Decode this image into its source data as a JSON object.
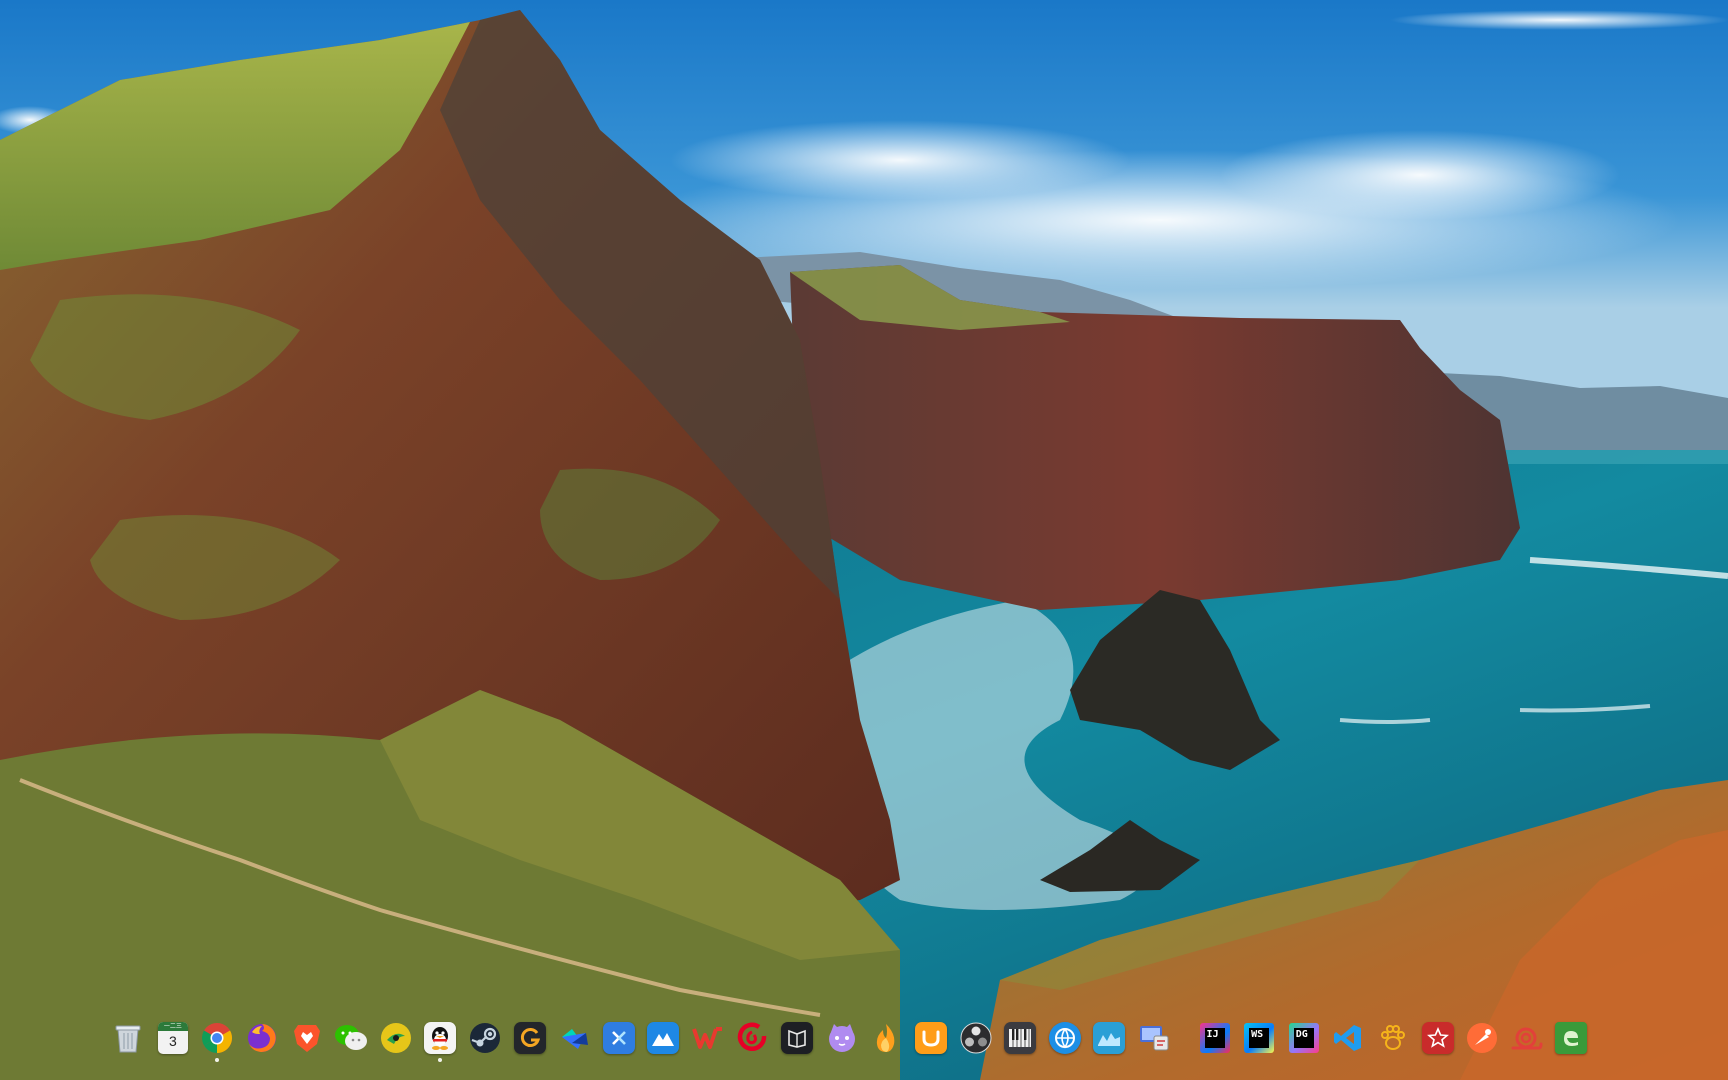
{
  "desktop": {
    "wallpaper": "coastal-cliffs-landscape"
  },
  "dock": {
    "calendar_day": "3",
    "calendar_month": "一二三",
    "badges": {
      "intellij": "IJ",
      "webstorm": "WS",
      "datagrip": "DG"
    },
    "items": [
      {
        "icon": "trash-icon"
      },
      {
        "icon": "calendar-icon"
      },
      {
        "icon": "chrome-icon"
      },
      {
        "icon": "firefox-icon"
      },
      {
        "icon": "brave-icon"
      },
      {
        "icon": "wechat-icon"
      },
      {
        "icon": "music-player-icon"
      },
      {
        "icon": "qq-icon"
      },
      {
        "icon": "steam-icon"
      },
      {
        "icon": "grammarly-icon"
      },
      {
        "icon": "feishu-icon"
      },
      {
        "icon": "remote-desktop-icon"
      },
      {
        "icon": "mountain-app-icon"
      },
      {
        "icon": "wps-office-icon"
      },
      {
        "icon": "netease-music-icon"
      },
      {
        "icon": "book-reader-icon"
      },
      {
        "icon": "cat-app-icon"
      },
      {
        "icon": "flame-app-icon"
      },
      {
        "icon": "orange-app-icon"
      },
      {
        "icon": "obs-icon"
      },
      {
        "icon": "keyboard-piano-icon"
      },
      {
        "icon": "browser-globe-icon"
      },
      {
        "icon": "system-monitor-icon"
      },
      {
        "icon": "display-settings-icon"
      },
      {
        "icon": "intellij-idea-icon"
      },
      {
        "icon": "webstorm-icon"
      },
      {
        "icon": "datagrip-icon"
      },
      {
        "icon": "vscode-icon"
      },
      {
        "icon": "paw-app-icon"
      },
      {
        "icon": "star-app-icon"
      },
      {
        "icon": "postman-icon"
      },
      {
        "icon": "snail-app-icon"
      },
      {
        "icon": "edge-icon"
      }
    ]
  }
}
